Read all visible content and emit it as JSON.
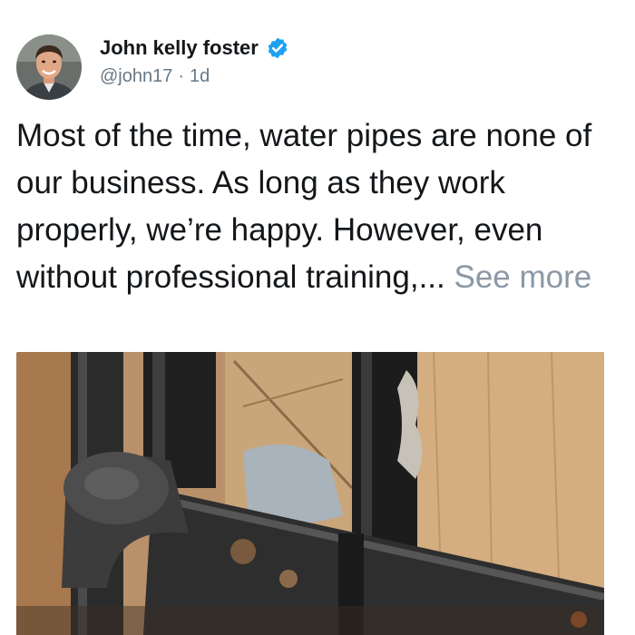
{
  "post": {
    "author": {
      "display_name": "John kelly foster",
      "handle": "@john17",
      "separator": "·",
      "time": "1d",
      "verified": true,
      "avatar_icon": "profile-photo"
    },
    "text": "Most of the time, water pipes are none of our business. As long as they work properly, we’re happy. However, even without professional training,... ",
    "see_more_label": "See more",
    "media": {
      "icon": "photo-of-corroded-black-water-pipes"
    },
    "colors": {
      "verified_badge": "#1da1f2",
      "meta_text": "#657786",
      "see_more": "#8b98a5"
    }
  }
}
